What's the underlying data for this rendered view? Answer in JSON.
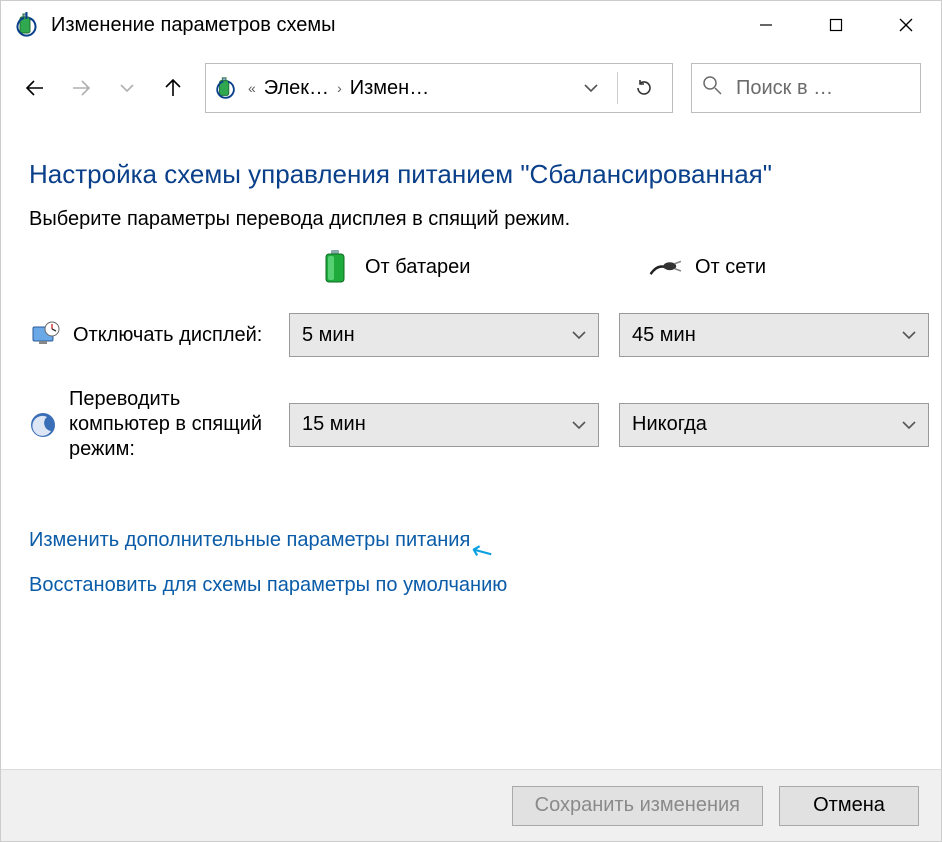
{
  "window": {
    "title": "Изменение параметров схемы"
  },
  "breadcrumb": {
    "seg1": "Элек…",
    "seg2": "Измен…"
  },
  "search": {
    "placeholder": "Поиск в …"
  },
  "page": {
    "heading": "Настройка схемы управления питанием \"Сбалансированная\"",
    "subtext": "Выберите параметры перевода дисплея в спящий режим."
  },
  "columns": {
    "battery": "От батареи",
    "plugged": "От сети"
  },
  "rows": {
    "display_off": {
      "label": "Отключать дисплей:",
      "battery": "5 мин",
      "plugged": "45 мин"
    },
    "sleep": {
      "label": "Переводить компьютер в спящий режим:",
      "battery": "15 мин",
      "plugged": "Никогда"
    }
  },
  "links": {
    "advanced": "Изменить дополнительные параметры питания",
    "restore": "Восстановить для схемы параметры по умолчанию"
  },
  "buttons": {
    "save": "Сохранить изменения",
    "cancel": "Отмена"
  },
  "glyphs": {
    "laquo": "«",
    "rsaquo": "›"
  }
}
